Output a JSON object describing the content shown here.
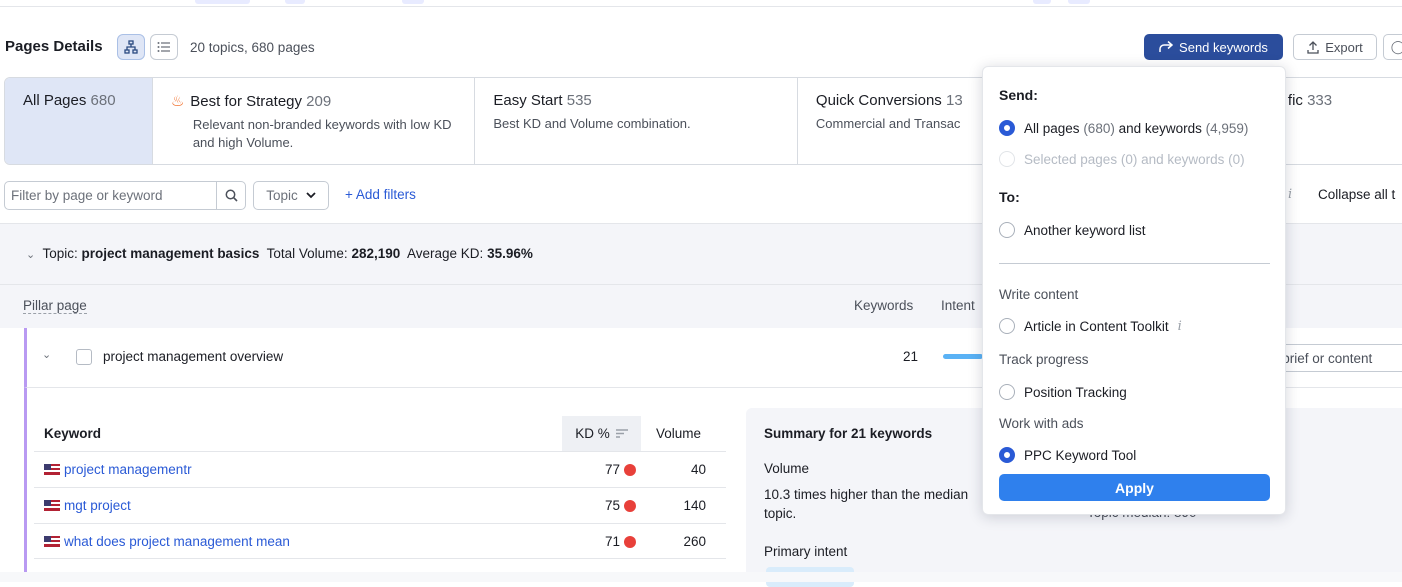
{
  "header": {
    "title": "Pages Details",
    "summary": "20 topics, 680 pages",
    "send_label": "Send keywords",
    "export_label": "Export"
  },
  "tabs": [
    {
      "name": "All Pages",
      "count": "680",
      "desc": ""
    },
    {
      "name": "Best for Strategy",
      "count": "209",
      "desc": "Relevant non-branded keywords with low KD and high Volume."
    },
    {
      "name": "Easy Start",
      "count": "535",
      "desc": "Best KD and Volume combination."
    },
    {
      "name": "Quick Conversions",
      "count": "13",
      "desc": "Commercial and Transac"
    },
    {
      "name": "fic",
      "count": "333",
      "desc": ""
    }
  ],
  "filters": {
    "search_placeholder": "Filter by page or keyword",
    "topic_label": "Topic",
    "add_filters": "+ Add filters",
    "collapse_label": "Collapse all t"
  },
  "topic": {
    "prefix": "Topic:",
    "name": "project management basics",
    "volume_label": "Total Volume:",
    "volume": "282,190",
    "kd_label": "Average KD:",
    "kd": "35.96%"
  },
  "pillar": {
    "header_label": "Pillar page",
    "keywords_header": "Keywords",
    "intent_header": "Intent",
    "page_name": "project management overview",
    "keyword_count": "21",
    "brief_label": "e brief or content"
  },
  "keyword_table": {
    "col_keyword": "Keyword",
    "col_kd": "KD %",
    "col_volume": "Volume",
    "rows": [
      {
        "keyword": "project managementr",
        "kd": "77",
        "volume": "40"
      },
      {
        "keyword": "mgt project",
        "kd": "75",
        "volume": "140"
      },
      {
        "keyword": "what does project management mean",
        "kd": "71",
        "volume": "260"
      }
    ]
  },
  "summary_panel": {
    "title": "Summary for 21 keywords",
    "volume_label": "Volume",
    "volume_desc": "10.3 times higher than the median topic.",
    "median": "Topic median: 890",
    "intent_label": "Primary intent"
  },
  "dropdown": {
    "send_heading": "Send:",
    "opt_all_prefix": "All pages",
    "opt_all_pages": "(680)",
    "opt_all_mid": "and keywords",
    "opt_all_kw": "(4,959)",
    "opt_selected": "Selected pages (0) and keywords (0)",
    "to_heading": "To:",
    "opt_another": "Another keyword list",
    "write_label": "Write content",
    "opt_article": "Article in Content Toolkit",
    "track_label": "Track progress",
    "opt_position": "Position Tracking",
    "ads_label": "Work with ads",
    "opt_ppc": "PPC Keyword Tool",
    "apply_label": "Apply"
  },
  "colors": {
    "primary": "#2b4d9c",
    "accent": "#2f80ed",
    "link": "#2a5ad6",
    "pillar_border": "#b99af2",
    "kd_dot": "#e8403a"
  }
}
